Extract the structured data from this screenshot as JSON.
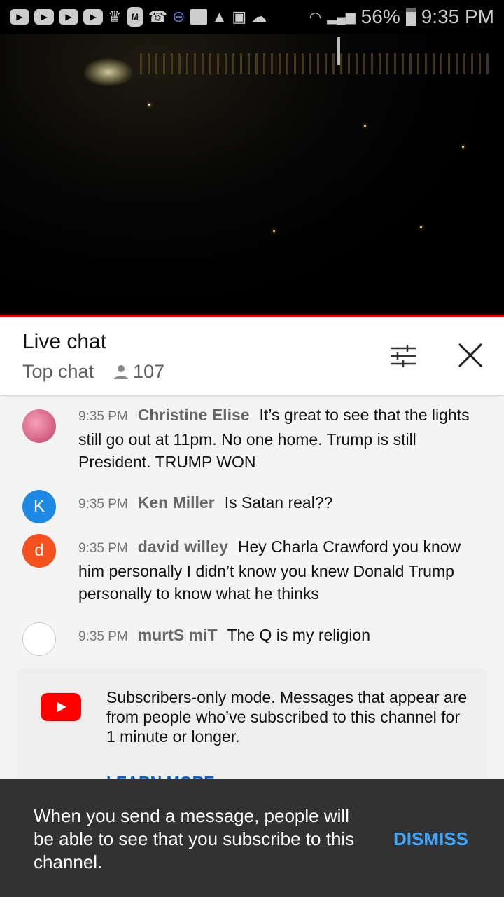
{
  "status_bar": {
    "battery": "56%",
    "time": "9:35 PM",
    "icons": [
      "youtube",
      "youtube",
      "youtube",
      "youtube",
      "crown",
      "m-app",
      "missed-call",
      "pokeball",
      "folder",
      "warning",
      "image",
      "cloud",
      "wifi",
      "signal",
      "battery"
    ]
  },
  "header": {
    "title": "Live chat",
    "mode": "Top chat",
    "viewers": "107"
  },
  "messages": [
    {
      "time": "9:35 PM",
      "author": "Christine Elise",
      "text": "It’s great to see that the lights still go out at 11pm. No one home. Trump is still President. TRUMP WON",
      "avatar": "",
      "avatar_color": "#e07090"
    },
    {
      "time": "9:35 PM",
      "author": "Ken Miller",
      "text": "Is Satan real??",
      "avatar": "K",
      "avatar_color": "#1e88e5"
    },
    {
      "time": "9:35 PM",
      "author": "david willey",
      "text": "Hey Charla Crawford you know him personally I didn’t know you knew Donald Trump personally to know what he thinks",
      "avatar": "d",
      "avatar_color": "#f4511e"
    },
    {
      "time": "9:35 PM",
      "author": "murtS miT",
      "text": "The Q is my religion",
      "avatar": "",
      "avatar_color": "#ffffff"
    }
  ],
  "banner": {
    "text": "Subscribers-only mode. Messages that appear are from people who’ve subscribed to this channel for 1 minute or longer.",
    "link": "LEARN MORE"
  },
  "toast": {
    "text": "When you send a message, people will be able to see that you subscribe to this channel.",
    "action": "DISMISS"
  }
}
